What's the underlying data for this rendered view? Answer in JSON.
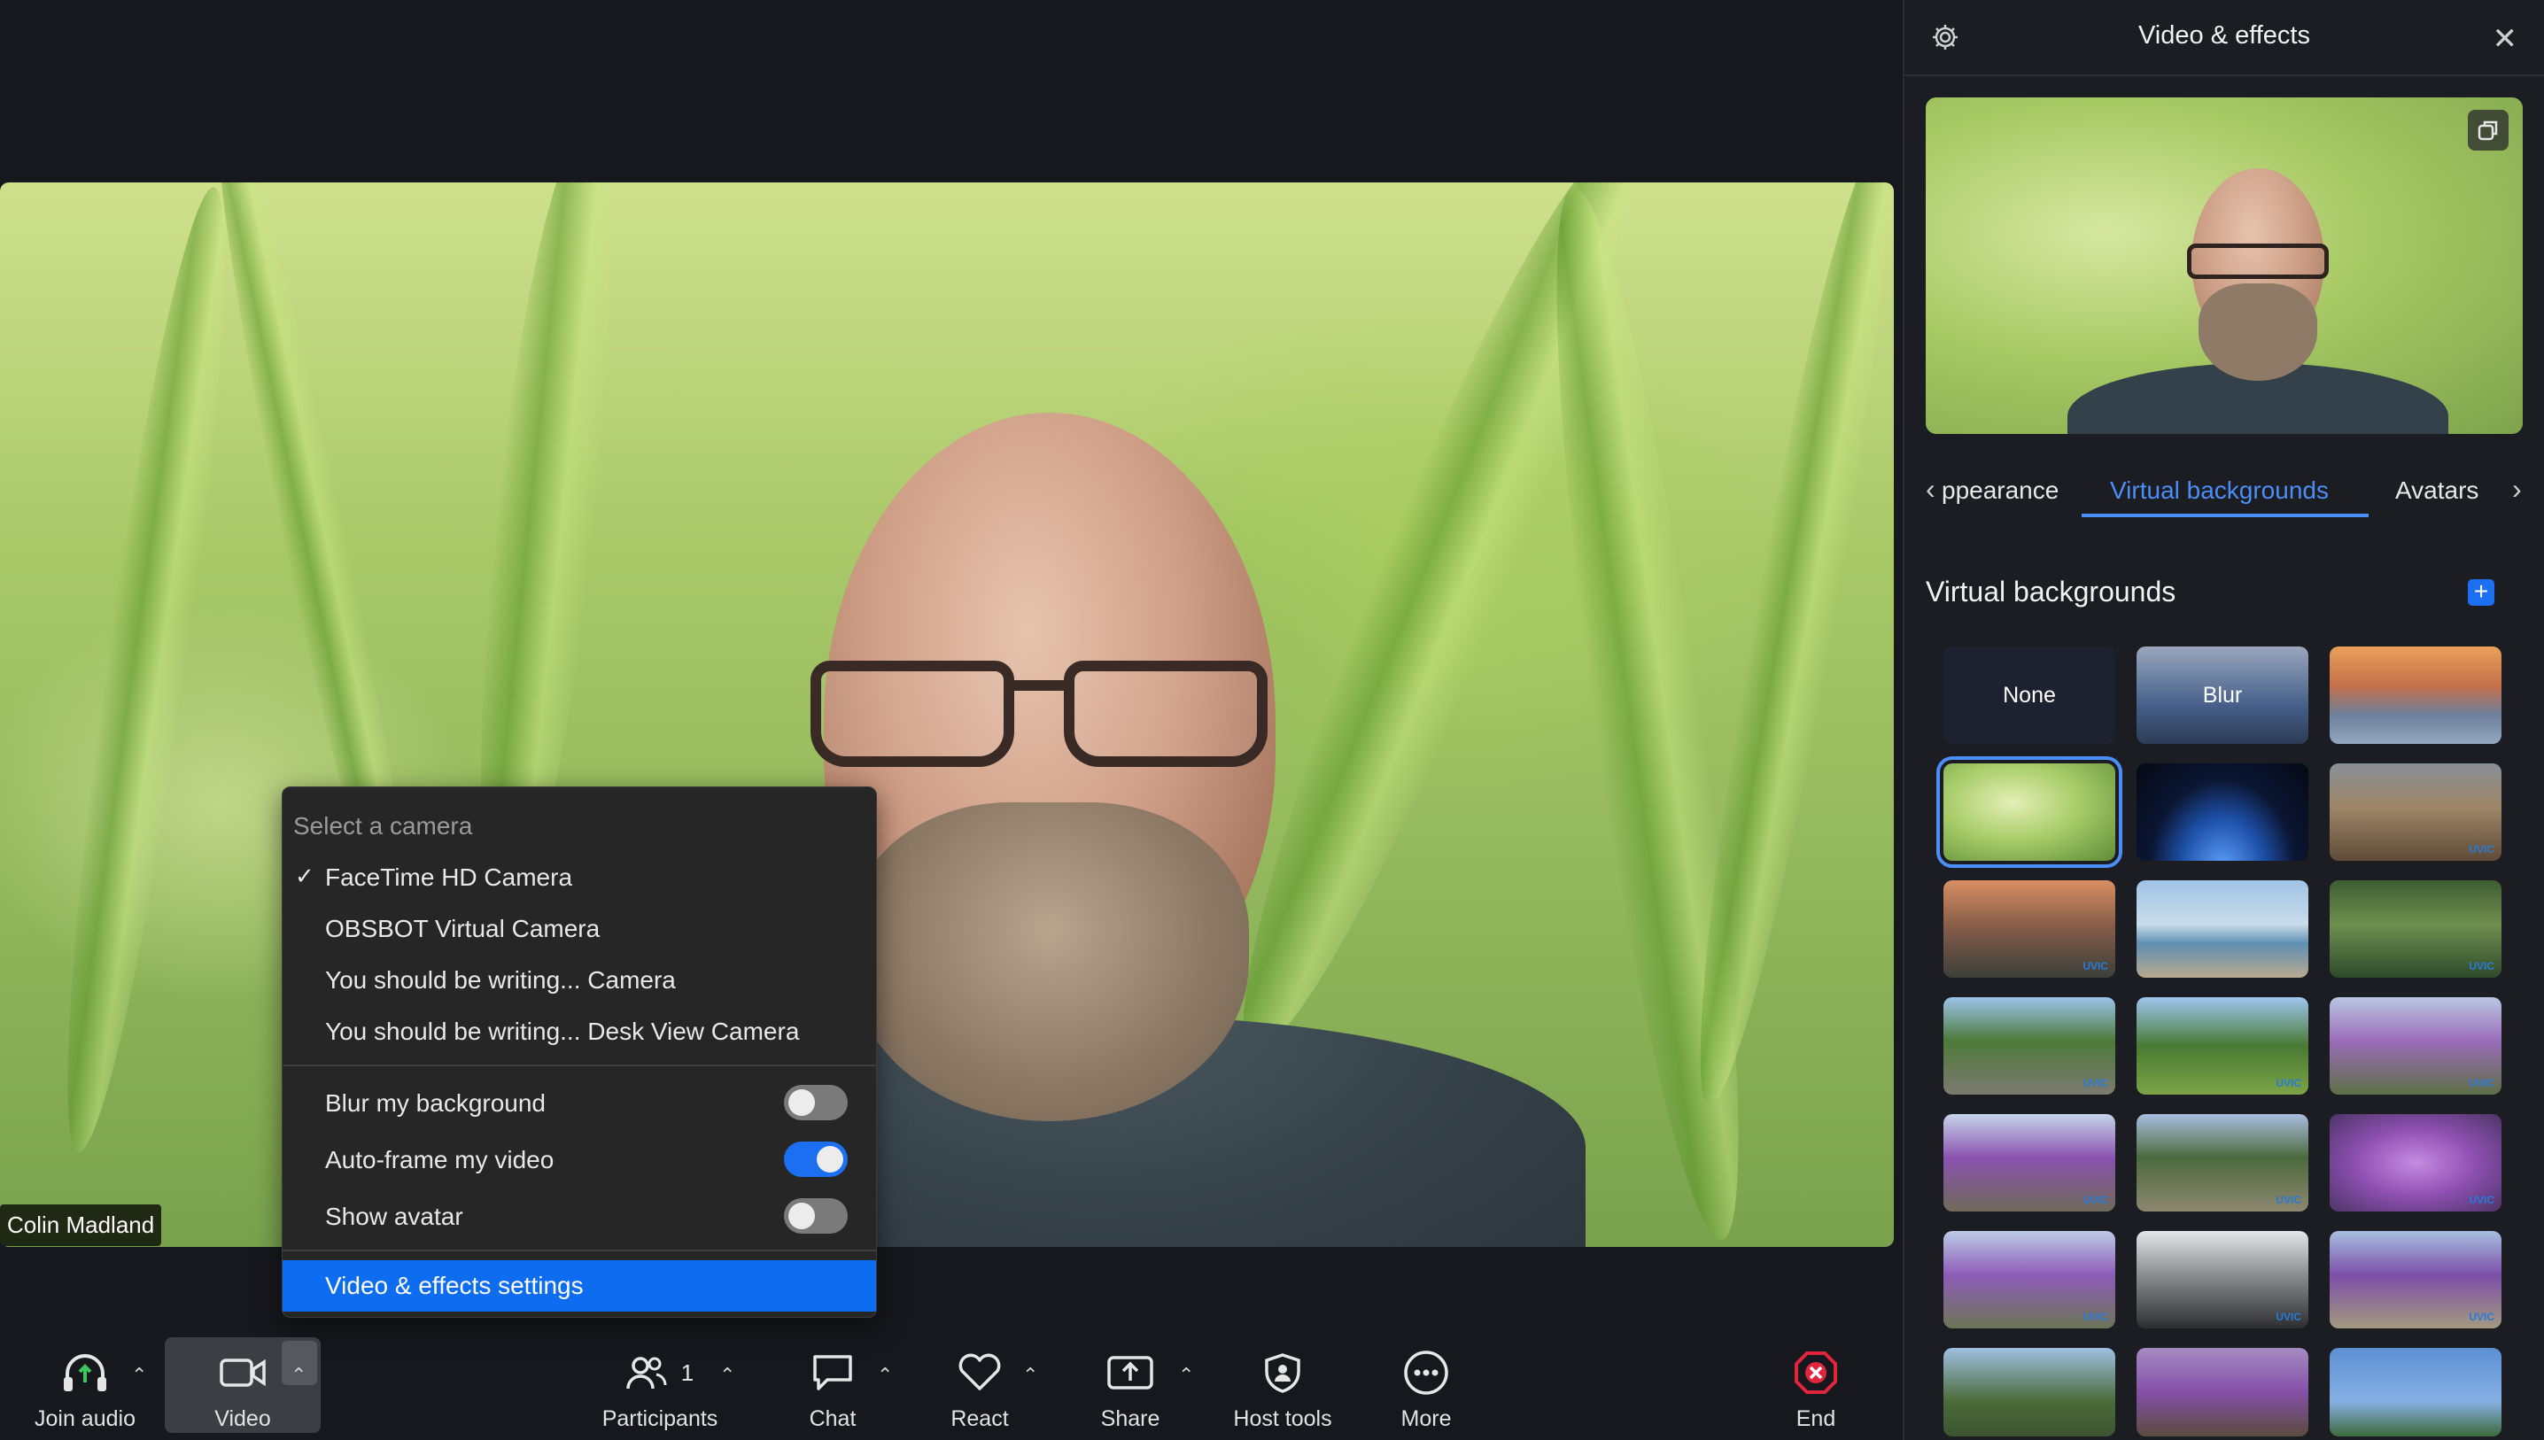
{
  "main_video": {
    "participant_name": "Colin Madland"
  },
  "camera_menu": {
    "header": "Select a camera",
    "cameras": [
      {
        "label": "FaceTime HD Camera",
        "selected": true
      },
      {
        "label": "OBSBOT Virtual Camera",
        "selected": false
      },
      {
        "label": "You should be writing... Camera",
        "selected": false
      },
      {
        "label": "You should be writing... Desk View Camera",
        "selected": false
      }
    ],
    "toggles": [
      {
        "label": "Blur my background",
        "on": false
      },
      {
        "label": "Auto-frame my video",
        "on": true
      },
      {
        "label": "Show avatar",
        "on": false
      }
    ],
    "settings_label": "Video & effects settings",
    "check_glyph": "✓"
  },
  "toolbar": {
    "join_audio": "Join audio",
    "video": "Video",
    "participants": "Participants",
    "participants_count": "1",
    "chat": "Chat",
    "react": "React",
    "share": "Share",
    "host_tools": "Host tools",
    "more": "More",
    "end": "End"
  },
  "panel": {
    "title": "Video & effects",
    "tabs": [
      {
        "label": "ppearance",
        "active": false
      },
      {
        "label": "Virtual backgrounds",
        "active": true
      },
      {
        "label": "Avatars",
        "active": false
      }
    ],
    "section_title": "Virtual backgrounds",
    "add_glyph": "+",
    "backgrounds": [
      {
        "label": "None",
        "kind": "none"
      },
      {
        "label": "Blur",
        "kind": "blur"
      },
      {
        "label": "",
        "kind": "golden-gate"
      },
      {
        "label": "",
        "kind": "grass",
        "selected": true
      },
      {
        "label": "",
        "kind": "earth-space"
      },
      {
        "label": "",
        "kind": "rainbow-building",
        "uvic": true
      },
      {
        "label": "",
        "kind": "sunset-water",
        "uvic": true
      },
      {
        "label": "",
        "kind": "beach",
        "uvic": false
      },
      {
        "label": "",
        "kind": "forest-stream",
        "uvic": true
      },
      {
        "label": "",
        "kind": "fountain-park",
        "uvic": true
      },
      {
        "label": "",
        "kind": "campus-field",
        "uvic": true
      },
      {
        "label": "",
        "kind": "cherry-blossom-1",
        "uvic": true
      },
      {
        "label": "",
        "kind": "purple-tree-1",
        "uvic": true
      },
      {
        "label": "",
        "kind": "purple-tree-2",
        "uvic": true
      },
      {
        "label": "",
        "kind": "purple-closeup",
        "uvic": true
      },
      {
        "label": "",
        "kind": "purple-tree-3",
        "uvic": true
      },
      {
        "label": "",
        "kind": "bare-tree",
        "uvic": true
      },
      {
        "label": "",
        "kind": "purple-tree-4",
        "uvic": true
      },
      {
        "label": "",
        "kind": "trees-sky",
        "uvic": false
      },
      {
        "label": "",
        "kind": "purple-building",
        "uvic": false
      },
      {
        "label": "",
        "kind": "palm-sky",
        "uvic": false
      }
    ],
    "uvic_label": "UVIC"
  },
  "colors": {
    "accent": "#4c8ef7",
    "menu_highlight": "#0e6cf0",
    "end_red": "#e0253d"
  }
}
